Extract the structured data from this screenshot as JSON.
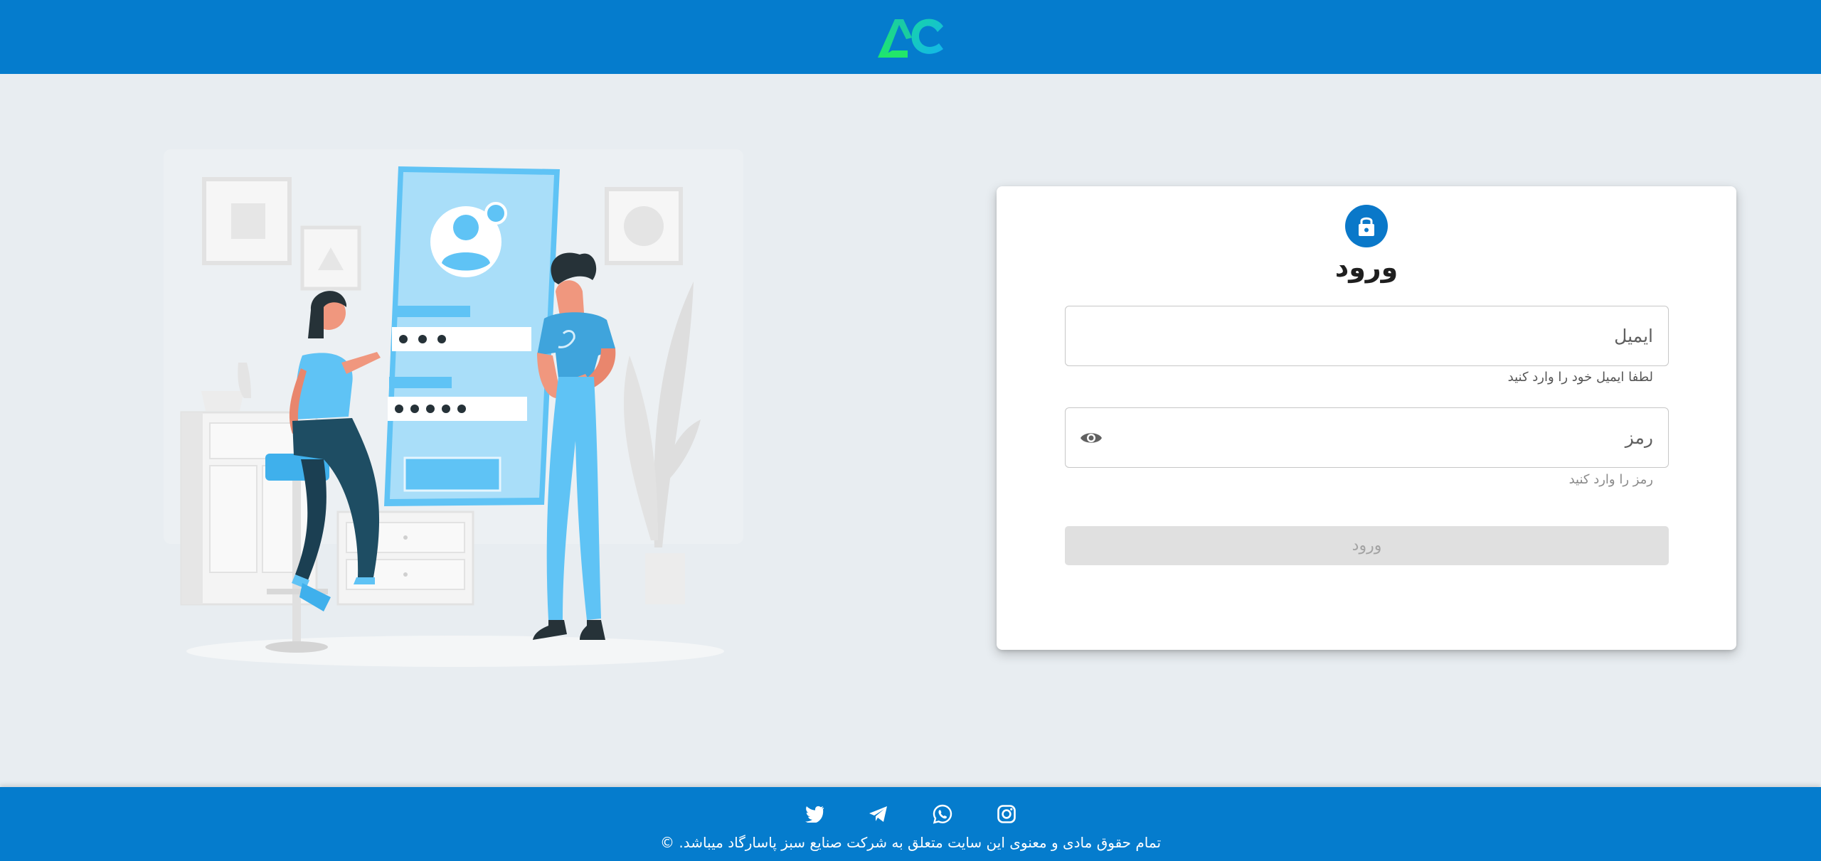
{
  "header": {
    "logo_icon": "ac-logo-icon",
    "logo_colors": [
      "#1fd37a",
      "#14b8e8"
    ]
  },
  "login_card": {
    "lock_icon": "lock-icon",
    "title": "ورود",
    "email": {
      "placeholder": "ایمیل",
      "value": "",
      "helper": "لطفا ایمیل خود را وارد کنید"
    },
    "password": {
      "placeholder": "رمز",
      "value": "",
      "helper": "رمز را وارد کنید",
      "toggle_icon": "eye-icon"
    },
    "submit_label": "ورود"
  },
  "footer": {
    "social": [
      {
        "name": "instagram-icon"
      },
      {
        "name": "whatsapp-icon"
      },
      {
        "name": "telegram-icon"
      },
      {
        "name": "twitter-icon"
      }
    ],
    "copyright": "تمام حقوق مادی و معنوی این سایت متعلق به شرکت صنایع سبز پاسارگاد میباشد. ©"
  },
  "colors": {
    "header": "#057ccd",
    "background": "#e8edf1",
    "accent": "#0a78c9",
    "button_disabled": "#e0e0e0"
  }
}
